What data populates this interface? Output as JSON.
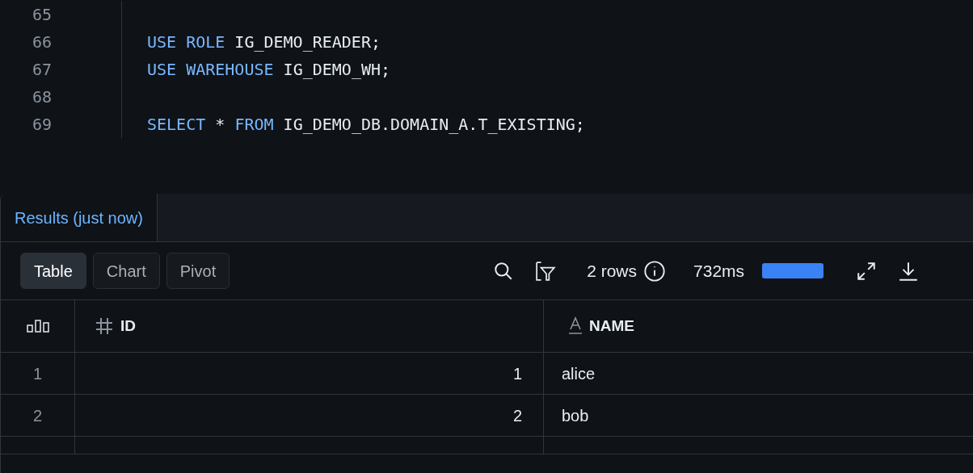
{
  "editor": {
    "lines": [
      {
        "number": "65"
      },
      {
        "number": "66",
        "tokens": [
          {
            "kind": "keyword",
            "text": "USE ROLE"
          },
          {
            "kind": "plain",
            "text": " IG_DEMO_READER;"
          }
        ]
      },
      {
        "number": "67",
        "tokens": [
          {
            "kind": "keyword",
            "text": "USE WAREHOUSE"
          },
          {
            "kind": "plain",
            "text": " IG_DEMO_WH;"
          }
        ]
      },
      {
        "number": "68"
      },
      {
        "number": "69",
        "tokens": [
          {
            "kind": "keyword",
            "text": "SELECT"
          },
          {
            "kind": "plain",
            "text": " * "
          },
          {
            "kind": "keyword",
            "text": "FROM"
          },
          {
            "kind": "plain",
            "text": " IG_DEMO_DB.DOMAIN_A.T_EXISTING;"
          }
        ]
      }
    ]
  },
  "results": {
    "tabs": [
      {
        "label": "Results (just now)",
        "selected": true
      }
    ],
    "views": [
      {
        "label": "Table",
        "selected": true
      },
      {
        "label": "Chart",
        "selected": false
      },
      {
        "label": "Pivot",
        "selected": false
      }
    ],
    "row_count": "2 rows",
    "duration": "732ms",
    "table": {
      "columns": [
        {
          "kind": "number",
          "label": "ID"
        },
        {
          "kind": "text",
          "label": "NAME"
        }
      ],
      "rows": [
        {
          "index": "1",
          "cells": [
            "1",
            "alice"
          ]
        },
        {
          "index": "2",
          "cells": [
            "2",
            "bob"
          ]
        }
      ]
    }
  }
}
